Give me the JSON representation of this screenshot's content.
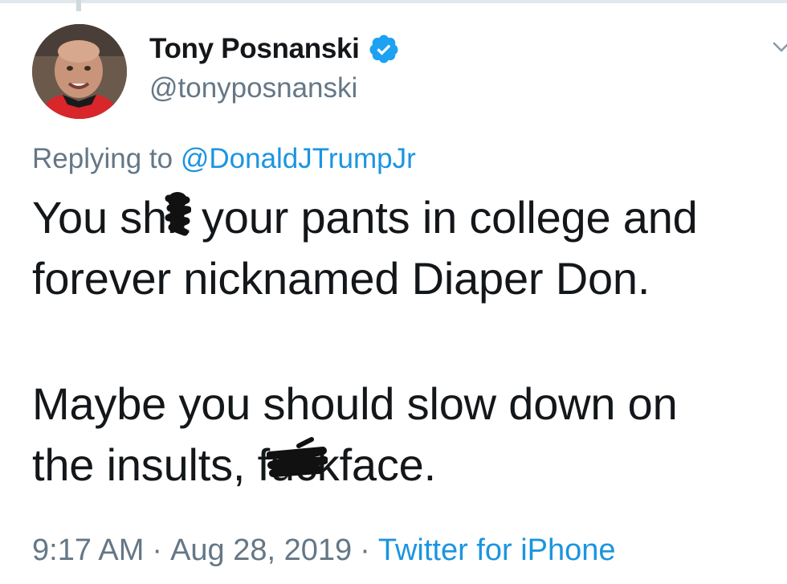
{
  "tweet": {
    "author": {
      "display_name": "Tony Posnanski",
      "handle": "@tonyposnanski",
      "verified": true,
      "avatar_icon": "profile-photo"
    },
    "reply": {
      "prefix": "Replying to ",
      "mention": "@DonaldJTrumpJr"
    },
    "text": {
      "line1_a": "You sh",
      "line1_censored": "it",
      "line1_b": " your pants in college and",
      "line2": "forever nicknamed Diaper Don.",
      "line3": "Maybe you should slow down on",
      "line4_a": "the insults, f",
      "line4_censored": "uc",
      "line4_b": "kface."
    },
    "meta": {
      "time": "9:17 AM",
      "separator": "·",
      "date": "Aug 28, 2019",
      "source": "Twitter for iPhone"
    }
  },
  "colors": {
    "text": "#14171a",
    "secondary": "#657786",
    "link": "#1b95e0",
    "verified": "#1da1f2"
  }
}
